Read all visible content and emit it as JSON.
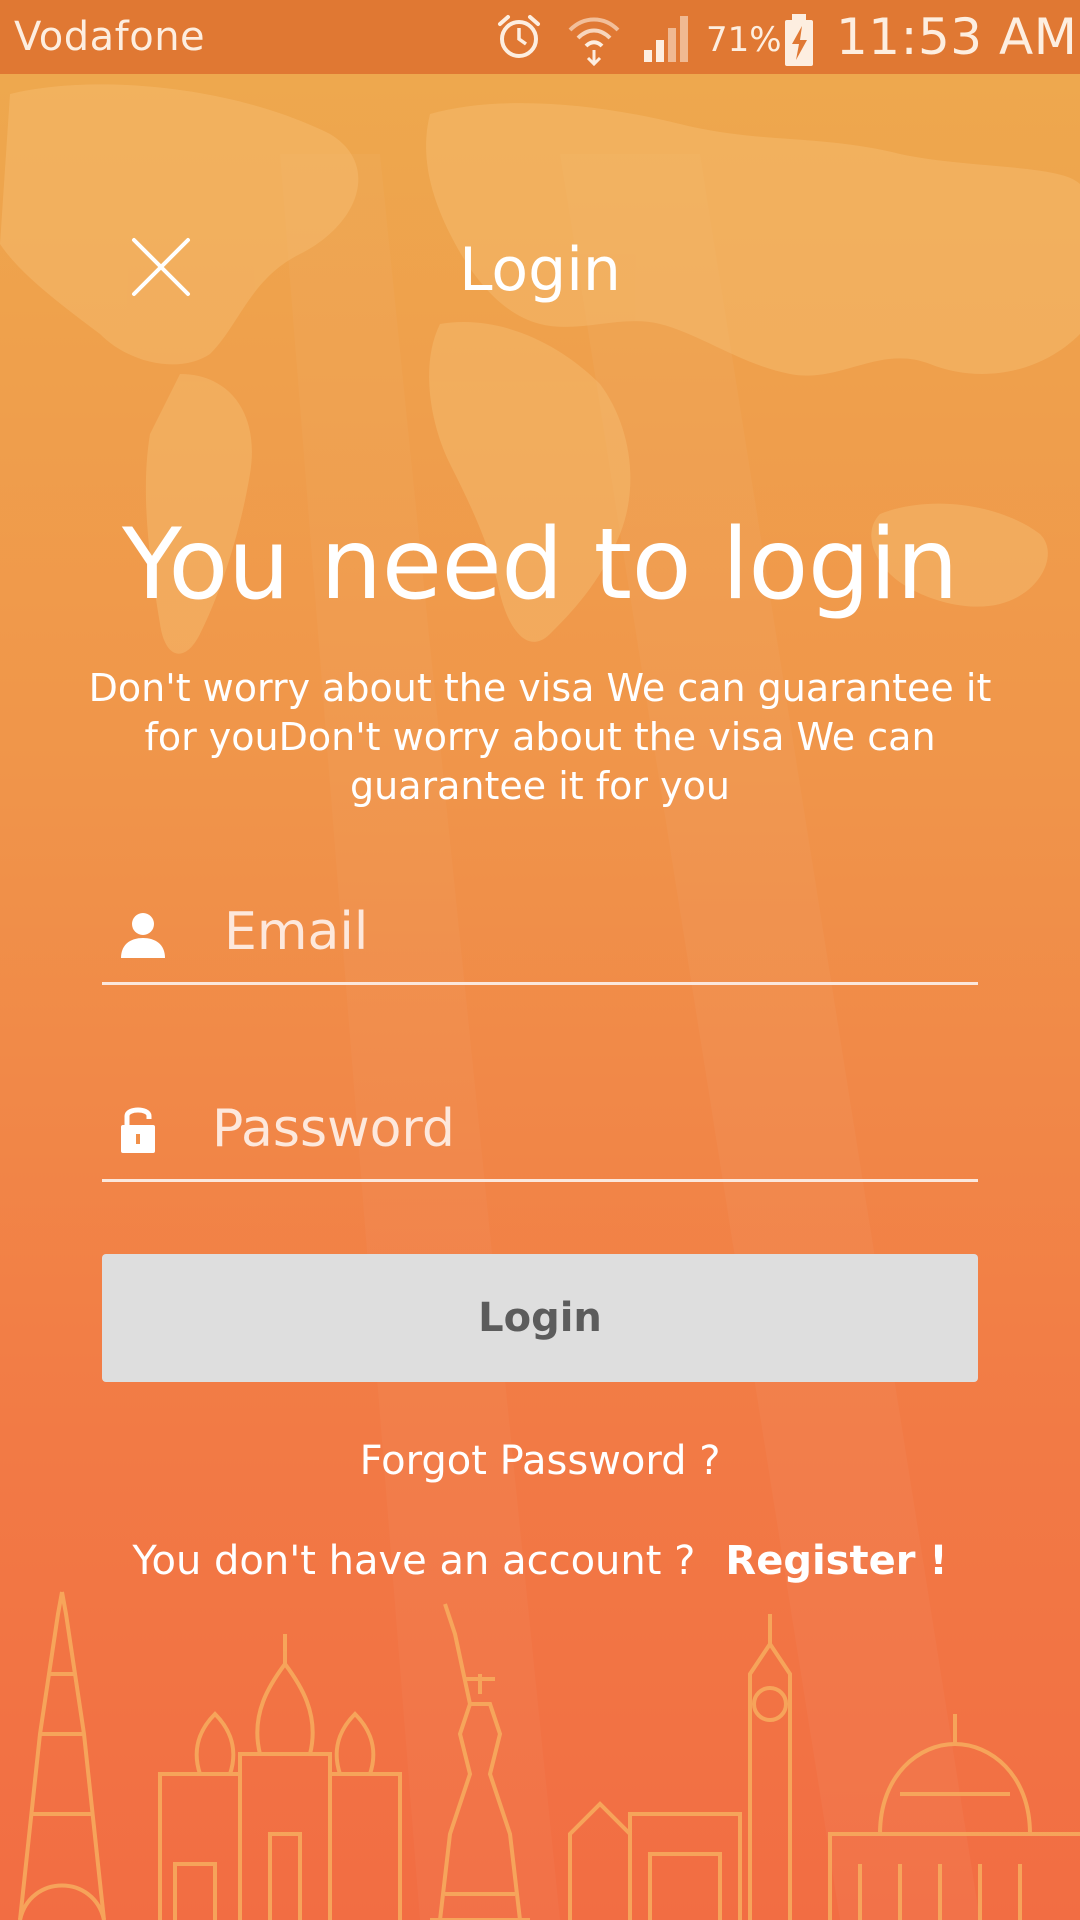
{
  "status_bar": {
    "carrier": "Vodafone",
    "battery_percent": "71%",
    "time": "11:53 AM",
    "icons": [
      "alarm-icon",
      "wifi-icon",
      "cellular-signal-icon",
      "battery-charging-icon"
    ]
  },
  "header": {
    "title": "Login",
    "close_icon": "close-icon"
  },
  "main": {
    "headline": "You need to login",
    "subtitle": "Don't worry about the visa We can guarantee it for youDon't worry about the visa We can guarantee it for you"
  },
  "form": {
    "email": {
      "placeholder": "Email",
      "value": "",
      "icon": "user-icon"
    },
    "password": {
      "placeholder": "Password",
      "value": "",
      "icon": "lock-icon"
    },
    "login_label": "Login",
    "forgot_label": "Forgot Password ?",
    "no_account_text": "You don't have an account ?",
    "register_label": "Register !"
  },
  "colors": {
    "status_bar": "#e07833",
    "background_top": "#eeaa4e",
    "background_bottom": "#f26d43",
    "button_bg": "#dedede",
    "button_text": "#5c5c5c",
    "text": "#ffffff"
  }
}
